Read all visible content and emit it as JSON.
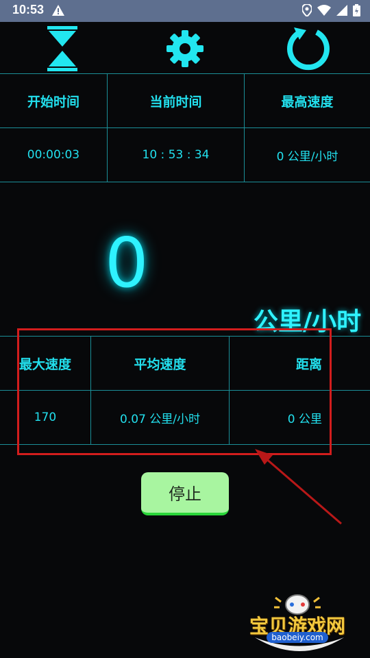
{
  "status_bar": {
    "time": "10:53",
    "warning_icon": "warning-icon",
    "icons": [
      "location-icon",
      "wifi-icon",
      "signal-icon",
      "battery-icon"
    ]
  },
  "toolbar": {
    "icons": [
      "hourglass-icon",
      "gear-icon",
      "refresh-icon"
    ]
  },
  "top_table": {
    "headers": [
      "开始时间",
      "当前时间",
      "最高速度"
    ],
    "values": [
      "00:00:03",
      "10 : 53 : 34",
      "0 公里/小时"
    ]
  },
  "speed": {
    "value": "0",
    "unit": "公里/小时"
  },
  "bottom_table": {
    "headers": [
      "最大速度",
      "平均速度",
      "距离"
    ],
    "values": [
      "170",
      "0.07 公里/小时",
      "0 公里"
    ]
  },
  "stop_button": {
    "label": "停止"
  },
  "watermark": {
    "title": "宝贝游戏网",
    "url": "baobeiy.com"
  },
  "colors": {
    "accent": "#22e0ee",
    "highlight": "#d21d1d",
    "stop_button_bg": "#a8f5a0",
    "status_bar": "#5e6f8f"
  }
}
